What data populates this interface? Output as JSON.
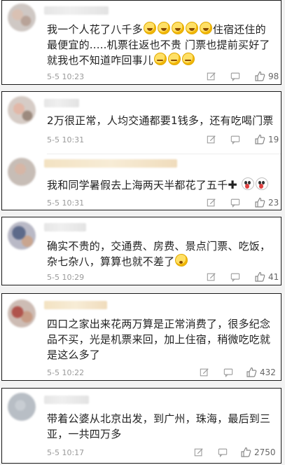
{
  "comments": [
    {
      "lines": [
        "我一个人花了八千多",
        "住宿还住的",
        "最便宜的.....机票往返也不贵 门票也提前买好了",
        "就我也不知道咋回事儿"
      ],
      "time": "5-5 10:23",
      "likes": "98"
    },
    {
      "lines": [
        "2万很正常，人均交通都要1钱多，还有吃喝门票"
      ],
      "time": "5-5 10:31",
      "likes": "19"
    },
    {
      "lines": [
        "我和同学暑假去上海两天半都花了五千"
      ],
      "time": "5-5 10:31",
      "likes": "23"
    },
    {
      "lines": [
        "确实不贵的，交通费、房费、景点门票、吃饭，",
        "杂七杂八，算算也就不差了"
      ],
      "time": "5-5 10:29",
      "likes": "41"
    },
    {
      "lines": [
        "四口之家出来花两万算是正常消费了，很多纪念",
        "品不买，光是机票来回，加上住宿，稍微吃吃就",
        "是这么多了"
      ],
      "time": "5-5 10:22",
      "likes": "432"
    },
    {
      "lines": [
        "带着公婆从北京出发，到广州，珠海，最后到三",
        "亚，一共四万多"
      ],
      "time": "5-5 10:17",
      "likes": "2750"
    }
  ],
  "icons": {
    "reply": "edit-icon",
    "like": "thumb-up-icon",
    "avatar": "blurred-avatar",
    "plus": "plus-sign"
  },
  "colors": {
    "text": "#222222",
    "meta": "#9a9a9a",
    "border": "#1a1a1a",
    "background": "#f2f2f2"
  }
}
